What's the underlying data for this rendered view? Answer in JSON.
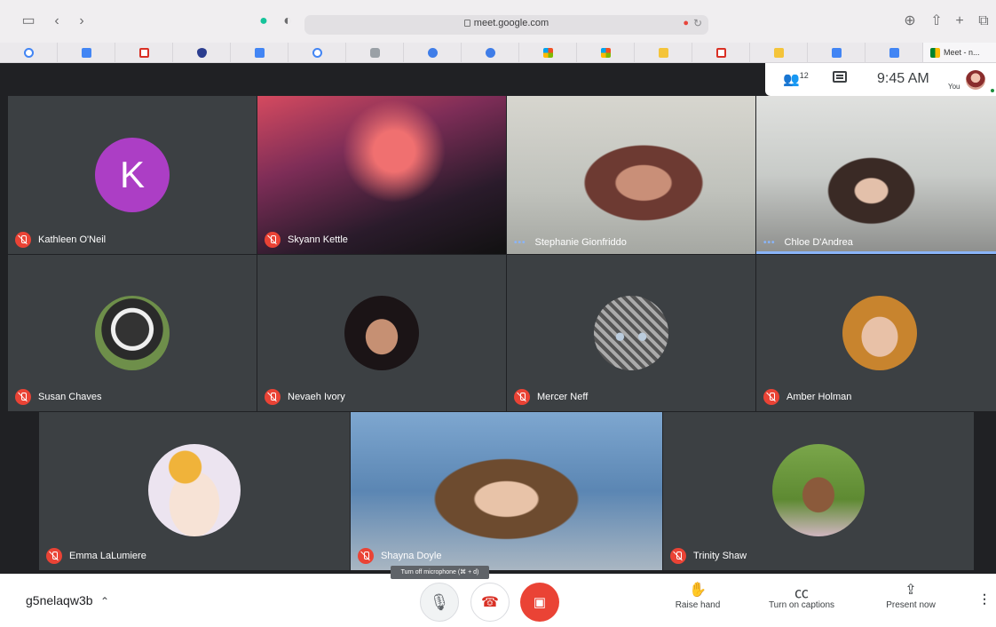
{
  "browser": {
    "url": "meet.google.com",
    "tab_meet_label": "Meet - n...",
    "icons": [
      "sidebar-icon",
      "back-icon",
      "forward-icon",
      "grammarly-icon",
      "privacy-icon",
      "download-icon",
      "share-icon",
      "new-tab-icon",
      "tabs-overview-icon"
    ],
    "bookmarks": [
      "google",
      "docs",
      "gmail",
      "shield",
      "docs",
      "google",
      "classroom-grey",
      "blue-circle",
      "blue-circle",
      "microsoft",
      "microsoft",
      "classroom",
      "gmail",
      "classroom",
      "docs",
      "docs"
    ]
  },
  "meet_header": {
    "people_count": "12",
    "time": "9:45 AM",
    "you_label": "You"
  },
  "participants": [
    {
      "name": "Kathleen O'Neil",
      "initial": "K",
      "muted": true
    },
    {
      "name": "Skyann Kettle",
      "muted": true
    },
    {
      "name": "Stephanie Gionfriddo",
      "muted": false
    },
    {
      "name": "Chloe D'Andrea",
      "muted": false
    },
    {
      "name": "Susan Chaves",
      "muted": true
    },
    {
      "name": "Nevaeh Ivory",
      "muted": true
    },
    {
      "name": "Mercer Neff",
      "muted": true
    },
    {
      "name": "Amber Holman",
      "muted": true
    },
    {
      "name": "Emma LaLumiere",
      "muted": true
    },
    {
      "name": "Shayna Doyle",
      "muted": true
    },
    {
      "name": "Trinity Shaw",
      "muted": true
    }
  ],
  "speaking_indicator": "•••",
  "bottom_bar": {
    "meeting_code": "g5nelaqw3b",
    "tooltip": "Turn off microphone (⌘ + d)",
    "raise_hand": "Raise hand",
    "captions": "Turn on captions",
    "present": "Present now"
  },
  "colors": {
    "accent_muted": "#ea4335",
    "speaking": "#8ab4f8",
    "letter_avatar": "#ac3ec5"
  }
}
